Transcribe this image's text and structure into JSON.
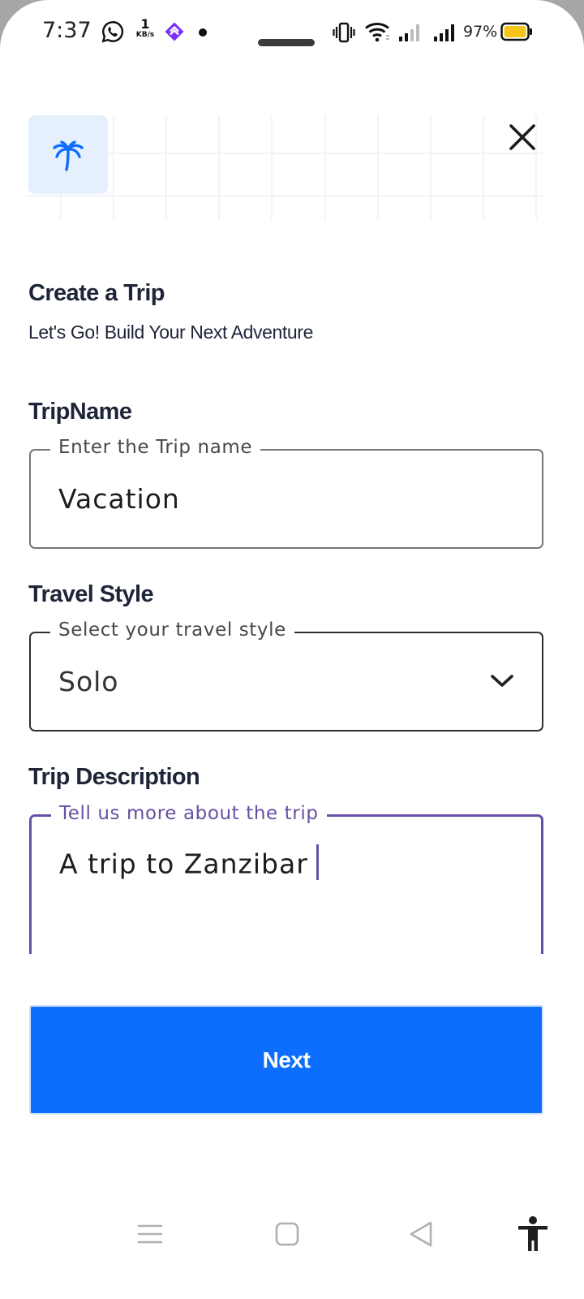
{
  "status_bar": {
    "time": "7:37",
    "network_speed_value": "1",
    "network_speed_unit": "KB/s",
    "battery_percent": "97%",
    "icons": [
      "whatsapp-icon",
      "app-notification-icon",
      "vibrate-icon",
      "wifi-icon",
      "signal-icon",
      "signal-icon",
      "battery-icon"
    ],
    "battery_color": "#f5c518"
  },
  "header": {
    "logo_icon": "palm-tree-icon",
    "logo_bg_color": "#e6f0fd",
    "logo_color": "#0d6efd",
    "close_icon": "close-icon"
  },
  "page": {
    "title": "Create a Trip",
    "subtitle": "Let's Go! Build Your Next Adventure"
  },
  "form": {
    "trip_name": {
      "label": "TripName",
      "legend": "Enter the Trip name",
      "value": "Vacation"
    },
    "travel_style": {
      "label": "Travel Style",
      "legend": "Select your travel style",
      "value": "Solo",
      "icon": "chevron-down-icon"
    },
    "description": {
      "label": "Trip Description",
      "legend": "Tell us more about the trip",
      "value": "A trip to Zanzibar",
      "accent_color": "#6750a4"
    }
  },
  "actions": {
    "next_label": "Next",
    "next_color": "#0d6efd"
  },
  "nav_bar": {
    "icons": [
      "menu-icon",
      "home-icon",
      "back-icon",
      "accessibility-icon"
    ]
  }
}
